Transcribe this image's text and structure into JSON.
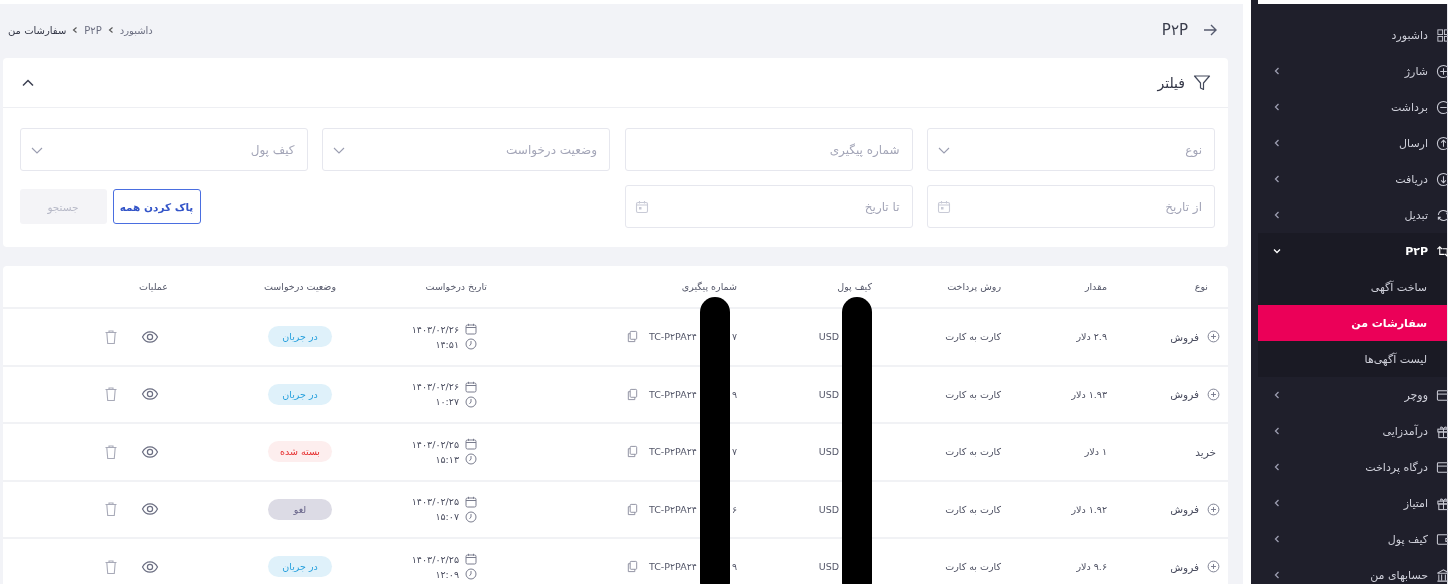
{
  "header": {
    "title": "P۲P",
    "breadcrumb": [
      {
        "label": "داشبورد",
        "current": false
      },
      {
        "label": "P۲P",
        "current": false
      },
      {
        "label": "سفارشات من",
        "current": true
      }
    ]
  },
  "filter": {
    "title": "فیلتر",
    "expanded": true,
    "fields": [
      {
        "kind": "select",
        "placeholder": "نوع"
      },
      {
        "kind": "text",
        "placeholder": "شماره پیگیری"
      },
      {
        "kind": "select",
        "placeholder": "وضعیت درخواست"
      },
      {
        "kind": "select",
        "placeholder": "کیف پول"
      },
      {
        "kind": "date",
        "placeholder": "از تاریخ"
      },
      {
        "kind": "date",
        "placeholder": "تا تاریخ"
      }
    ],
    "buttons": [
      {
        "label": "پاک کردن همه",
        "disabled": false
      },
      {
        "label": "جستجو",
        "disabled": true
      }
    ]
  },
  "table": {
    "columns": [
      "نوع",
      "مقدار",
      "روش پرداخت",
      "کیف پول",
      "شماره پیگیری",
      "تاریخ درخواست",
      "وضعیت درخواست",
      "عملیات"
    ],
    "rows": [
      {
        "type": "فروش",
        "expandable": true,
        "amount": "۲.۹ دلار",
        "payment_method": "کارت به کارت",
        "wallet": "USD",
        "wallet_redacted": true,
        "tracking": "TC-P۲PA۲۴",
        "tracking_redacted": true,
        "tracking_tail": "۷",
        "date": "۱۴۰۳/۰۲/۲۶",
        "time": "۱۴:۵۱",
        "status": "در جریان",
        "color": "#dff1fa"
      },
      {
        "type": "فروش",
        "expandable": true,
        "amount": "۱.۹۳ دلار",
        "payment_method": "کارت به کارت",
        "wallet": "USD",
        "wallet_redacted": true,
        "tracking": "TC-P۲PA۲۴",
        "tracking_redacted": true,
        "tracking_tail": "۹",
        "date": "۱۴۰۳/۰۲/۲۶",
        "time": "۱۰:۲۷",
        "status": "در جریان",
        "color": "#dff1fa"
      },
      {
        "type": "خرید",
        "expandable": false,
        "amount": "۱ دلار",
        "payment_method": "کارت به کارت",
        "wallet": "USD",
        "wallet_redacted": true,
        "tracking": "TC-P۲PA۲۴",
        "tracking_redacted": true,
        "tracking_tail": "۷",
        "date": "۱۴۰۳/۰۲/۲۵",
        "time": "۱۵:۱۳",
        "status": "بسته شده",
        "color": "#fdeeee"
      },
      {
        "type": "فروش",
        "expandable": true,
        "amount": "۱.۹۲ دلار",
        "payment_method": "کارت به کارت",
        "wallet": "USD",
        "wallet_redacted": true,
        "tracking": "TC-P۲PA۲۴",
        "tracking_redacted": true,
        "tracking_tail": "۶",
        "date": "۱۴۰۳/۰۲/۲۵",
        "time": "۱۵:۰۷",
        "status": "لغو",
        "color": "#dcdbe5"
      },
      {
        "type": "فروش",
        "expandable": true,
        "amount": "۹.۶ دلار",
        "payment_method": "کارت به کارت",
        "wallet": "USD",
        "wallet_redacted": true,
        "tracking": "TC-P۲PA۲۴",
        "tracking_redacted": true,
        "tracking_tail": "۹",
        "date": "۱۴۰۳/۰۲/۲۵",
        "time": "۱۲:۰۹",
        "status": "در جریان",
        "color": "#dff1fa"
      }
    ]
  },
  "sidebar": {
    "items": [
      {
        "kind": "link",
        "label": "داشبورد"
      },
      {
        "kind": "group",
        "label": "شارژ",
        "expanded": false
      },
      {
        "kind": "group",
        "label": "برداشت",
        "expanded": false
      },
      {
        "kind": "group",
        "label": "ارسال",
        "expanded": false
      },
      {
        "kind": "group",
        "label": "دریافت",
        "expanded": false
      },
      {
        "kind": "group",
        "label": "تبدیل",
        "expanded": false
      },
      {
        "kind": "group",
        "label": "P۲P",
        "expanded": true,
        "children": [
          {
            "label": "ساخت آگهی",
            "selected": false
          },
          {
            "label": "سفارشات من",
            "selected": true
          },
          {
            "label": "لیست آگهی‌ها",
            "selected": false
          }
        ]
      },
      {
        "kind": "group",
        "label": "ووچر",
        "expanded": false
      },
      {
        "kind": "group",
        "label": "درآمدزایی",
        "expanded": false
      },
      {
        "kind": "group",
        "label": "درگاه پرداخت",
        "expanded": false
      },
      {
        "kind": "group",
        "label": "امتیاز",
        "expanded": false
      },
      {
        "kind": "group",
        "label": "کیف پول",
        "expanded": false
      },
      {
        "kind": "group",
        "label": "حسابهای من",
        "expanded": false
      }
    ]
  }
}
